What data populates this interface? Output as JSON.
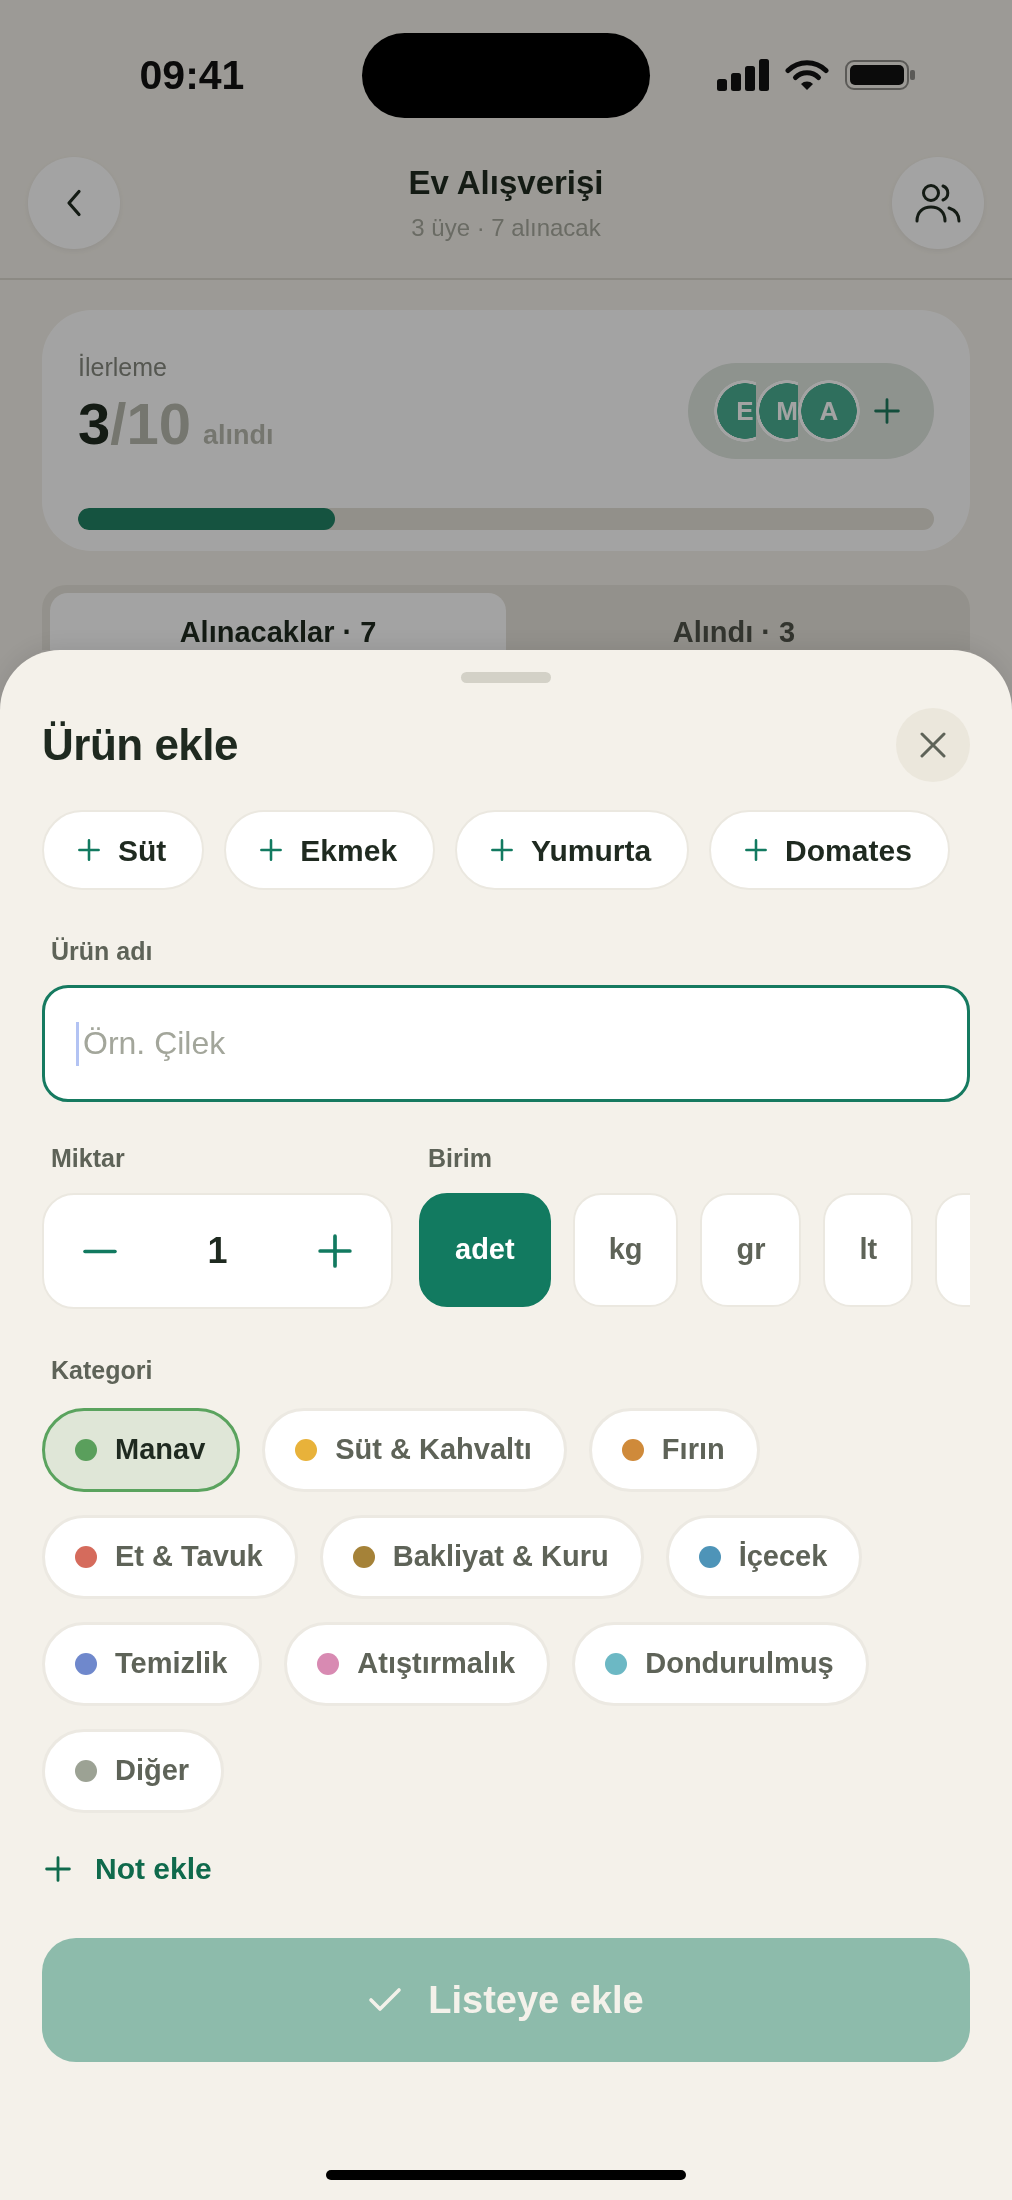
{
  "status_bar": {
    "time": "09:41"
  },
  "header": {
    "title": "Ev Alışverişi",
    "subtitle": "3 üye · 7 alınacak"
  },
  "progress": {
    "label": "İlerleme",
    "count": "3",
    "total": "/10",
    "suffix": "alındı",
    "level": 0.3,
    "members": [
      {
        "initial": "E"
      },
      {
        "initial": "M"
      },
      {
        "initial": "A"
      }
    ]
  },
  "tabs": [
    {
      "label": "Alınacaklar · 7",
      "selected": true
    },
    {
      "label": "Alındı · 3",
      "selected": false
    }
  ],
  "sheet": {
    "title": "Ürün ekle",
    "quick_items": [
      {
        "label": "Süt"
      },
      {
        "label": "Ekmek"
      },
      {
        "label": "Yumurta"
      },
      {
        "label": "Domates"
      }
    ],
    "name_field": {
      "label": "Ürün adı",
      "placeholder": "Örn. Çilek",
      "focused": true
    },
    "quantity": {
      "label": "Miktar",
      "value": "1"
    },
    "unit": {
      "label": "Birim",
      "options": [
        {
          "label": "adet",
          "selected": true
        },
        {
          "label": "kg",
          "selected": false
        },
        {
          "label": "gr",
          "selected": false
        },
        {
          "label": "lt",
          "selected": false
        },
        {
          "selected": false
        }
      ]
    },
    "category": {
      "label": "Kategori",
      "options": [
        {
          "label": "Manav",
          "color": "#5a9f5c",
          "selected": true
        },
        {
          "label": "Süt & Kahvaltı",
          "color": "#e8b23a",
          "selected": false
        },
        {
          "label": "Fırın",
          "color": "#cf8a3a",
          "selected": false
        },
        {
          "label": "Et & Tavuk",
          "color": "#d56b5c",
          "selected": false
        },
        {
          "label": "Bakliyat & Kuru",
          "color": "#a58238",
          "selected": false
        },
        {
          "label": "İçecek",
          "color": "#4e94b8",
          "selected": false
        },
        {
          "label": "Temizlik",
          "color": "#6f88cc",
          "selected": false
        },
        {
          "label": "Atıştırmalık",
          "color": "#d88ab2",
          "selected": false
        },
        {
          "label": "Dondurulmuş",
          "color": "#6cb8c4",
          "selected": false
        },
        {
          "label": "Diğer",
          "color": "#9ca294",
          "selected": false
        }
      ]
    },
    "add_note": {
      "label": "Not ekle"
    },
    "submit": {
      "label": "Listeye ekle",
      "disabled": true
    }
  }
}
